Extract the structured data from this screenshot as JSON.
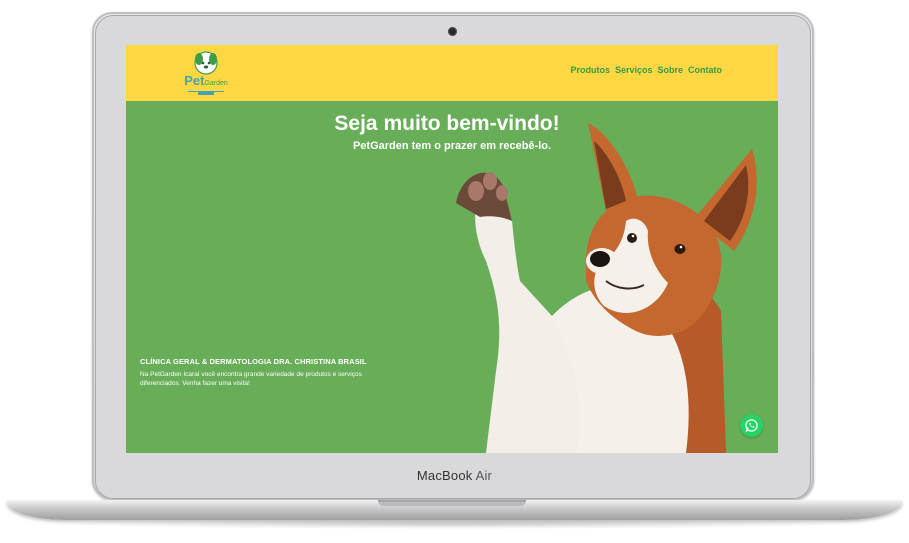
{
  "device": {
    "brand": "MacBook",
    "model": "Air"
  },
  "site": {
    "logo": {
      "main": "Pet",
      "secondary": "Garden"
    },
    "nav": [
      "Produtos",
      "Serviços",
      "Sobre",
      "Contato"
    ],
    "hero": {
      "title": "Seja muito bem-vindo!",
      "subtitle": "PetGarden tem o prazer em recebê-lo."
    },
    "clinic": {
      "title": "CLÍNICA GERAL & DERMATOLOGIA DRA. CHRISTINA BRASIL",
      "description": "Na PetGarden Icaraí você encontra grande variedade de produtos e serviços diferenciados. Venha fazer uma visita!"
    },
    "colors": {
      "header": "#fed843",
      "hero_background": "#68ad58",
      "nav_text": "#3c9a3f",
      "whatsapp": "#25d366"
    },
    "icons": {
      "whatsapp": "whatsapp-icon",
      "logo": "dog-logo-icon"
    }
  }
}
